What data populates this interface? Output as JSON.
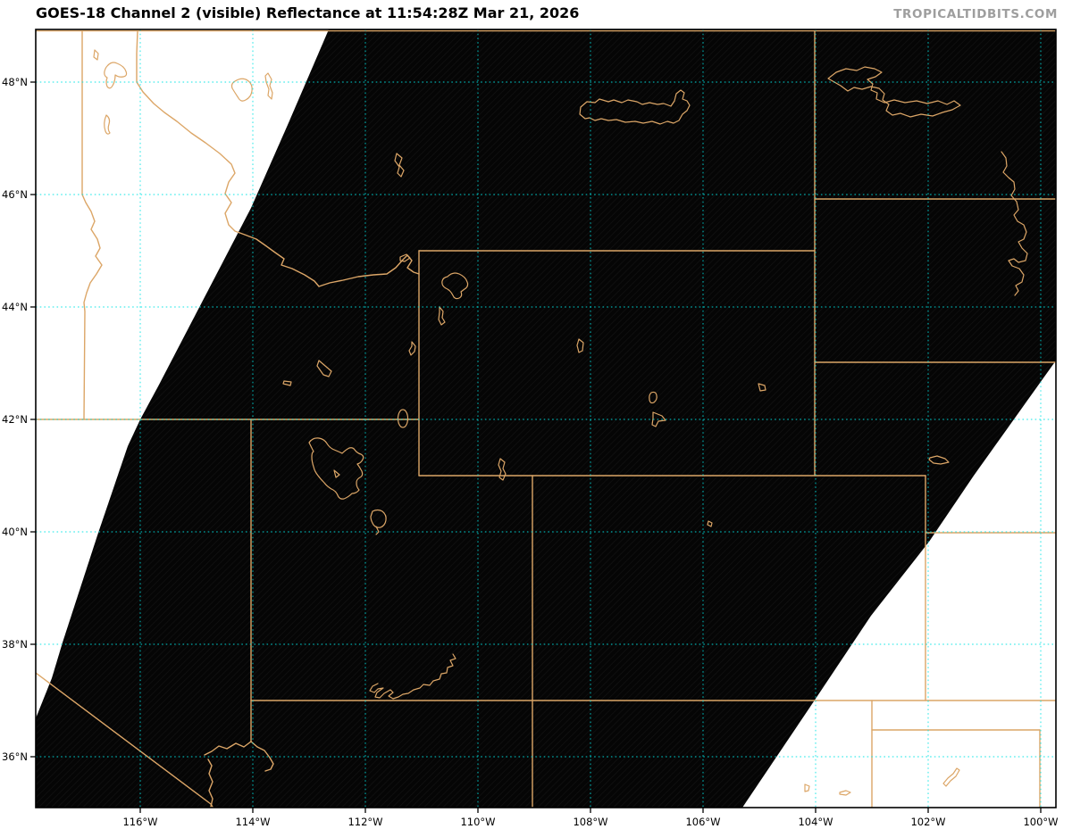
{
  "header": {
    "title": "GOES-18 Channel 2 (visible) Reflectance at 11:54:28Z Mar 21, 2026",
    "watermark": "TROPICALTIDBITS.COM"
  },
  "axes": {
    "lat_ticks": [
      "48°N",
      "46°N",
      "44°N",
      "42°N",
      "40°N",
      "38°N",
      "36°N"
    ],
    "lon_ticks": [
      "116°W",
      "114°W",
      "112°W",
      "110°W",
      "108°W",
      "106°W",
      "104°W",
      "102°W",
      "100°W"
    ]
  },
  "colors": {
    "boundary_orange": "#dca667",
    "grid_cyan": "#00e3e3",
    "satellite_dark": "#050505",
    "no_data_white": "#ffffff",
    "watermark_gray": "#9e9e9e"
  }
}
